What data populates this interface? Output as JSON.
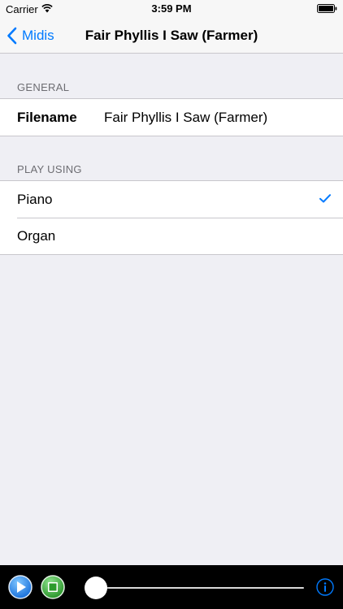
{
  "status_bar": {
    "carrier": "Carrier",
    "time": "3:59 PM"
  },
  "nav": {
    "back_label": "Midis",
    "title": "Fair Phyllis I Saw (Farmer)"
  },
  "general": {
    "header": "GENERAL",
    "filename_label": "Filename",
    "filename_value": "Fair Phyllis I Saw (Farmer)"
  },
  "play_using": {
    "header": "PLAY USING",
    "options": [
      {
        "label": "Piano",
        "selected": true
      },
      {
        "label": "Organ",
        "selected": false
      }
    ]
  },
  "player": {
    "progress": 0
  },
  "colors": {
    "accent": "#007aff",
    "background": "#efeff4",
    "header_text": "#6d6d72",
    "separator": "#c8c7cc",
    "player_bar": "#000000"
  },
  "icons": {
    "wifi": "wifi-icon",
    "battery": "battery-icon",
    "back": "chevron-left-icon",
    "check": "checkmark-icon",
    "play": "play-icon",
    "stop": "stop-icon",
    "info": "info-icon"
  }
}
